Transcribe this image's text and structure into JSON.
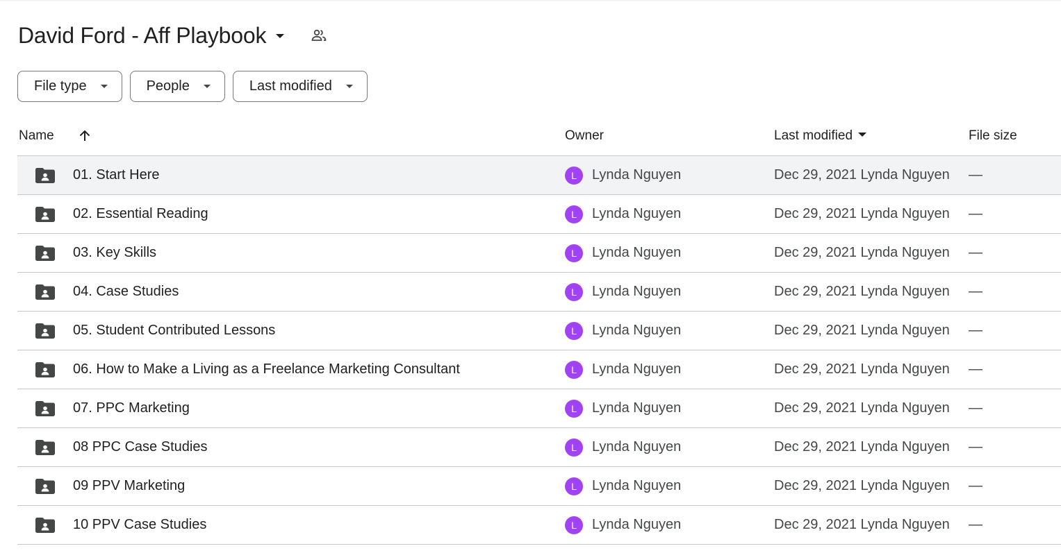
{
  "header": {
    "folder_title": "David Ford - Aff Playbook",
    "title_icon": "caret-down-icon",
    "shared_icon": "people-icon"
  },
  "filters": [
    {
      "label": "File type"
    },
    {
      "label": "People"
    },
    {
      "label": "Last modified"
    }
  ],
  "columns": {
    "name": "Name",
    "owner": "Owner",
    "last_modified": "Last modified",
    "file_size": "File size"
  },
  "colors": {
    "avatar": "#a142f4",
    "selected_row": "#f1f3f4",
    "folder_icon": "#444746"
  },
  "rows": [
    {
      "name": "01. Start Here",
      "avatar_letter": "L",
      "owner": "Lynda Nguyen",
      "modified": "Dec 29, 2021 Lynda Nguyen",
      "size": "—",
      "selected": true
    },
    {
      "name": "02. Essential Reading",
      "avatar_letter": "L",
      "owner": "Lynda Nguyen",
      "modified": "Dec 29, 2021 Lynda Nguyen",
      "size": "—"
    },
    {
      "name": "03. Key Skills",
      "avatar_letter": "L",
      "owner": "Lynda Nguyen",
      "modified": "Dec 29, 2021 Lynda Nguyen",
      "size": "—"
    },
    {
      "name": "04. Case Studies",
      "avatar_letter": "L",
      "owner": "Lynda Nguyen",
      "modified": "Dec 29, 2021 Lynda Nguyen",
      "size": "—"
    },
    {
      "name": "05. Student Contributed Lessons",
      "avatar_letter": "L",
      "owner": "Lynda Nguyen",
      "modified": "Dec 29, 2021 Lynda Nguyen",
      "size": "—"
    },
    {
      "name": "06. How to Make a Living as a Freelance Marketing Consultant",
      "avatar_letter": "L",
      "owner": "Lynda Nguyen",
      "modified": "Dec 29, 2021 Lynda Nguyen",
      "size": "—"
    },
    {
      "name": "07. PPC Marketing",
      "avatar_letter": "L",
      "owner": "Lynda Nguyen",
      "modified": "Dec 29, 2021 Lynda Nguyen",
      "size": "—"
    },
    {
      "name": "08 PPC Case Studies",
      "avatar_letter": "L",
      "owner": "Lynda Nguyen",
      "modified": "Dec 29, 2021 Lynda Nguyen",
      "size": "—"
    },
    {
      "name": "09 PPV Marketing",
      "avatar_letter": "L",
      "owner": "Lynda Nguyen",
      "modified": "Dec 29, 2021 Lynda Nguyen",
      "size": "—"
    },
    {
      "name": "10 PPV Case Studies",
      "avatar_letter": "L",
      "owner": "Lynda Nguyen",
      "modified": "Dec 29, 2021 Lynda Nguyen",
      "size": "—"
    }
  ]
}
